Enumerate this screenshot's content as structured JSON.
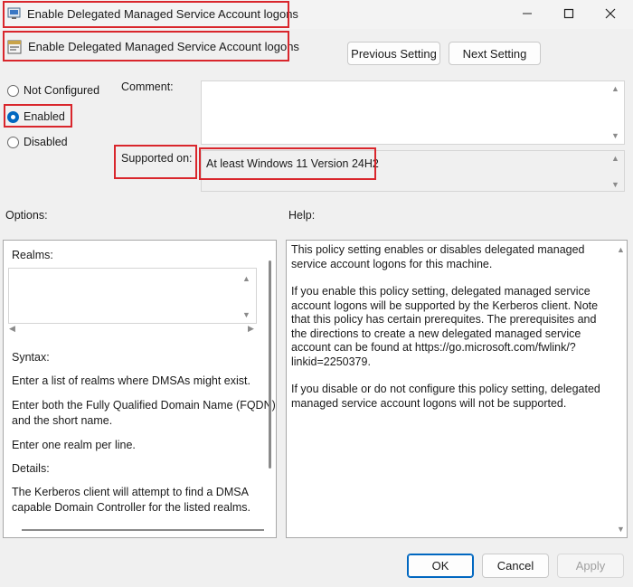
{
  "window": {
    "title": "Enable Delegated Managed Service Account logons",
    "minimize_icon": "minimize-icon",
    "maximize_icon": "maximize-icon",
    "close_icon": "close-icon"
  },
  "header": {
    "setting_name": "Enable Delegated Managed Service Account logons",
    "previous_label": "Previous Setting",
    "next_label": "Next Setting"
  },
  "state": {
    "options": [
      {
        "label": "Not Configured",
        "selected": false
      },
      {
        "label": "Enabled",
        "selected": true
      },
      {
        "label": "Disabled",
        "selected": false
      }
    ]
  },
  "comment": {
    "label": "Comment:",
    "value": ""
  },
  "supported": {
    "label": "Supported on:",
    "value": "At least Windows 11 Version 24H2"
  },
  "options_panel": {
    "heading": "Options:",
    "realms_label": "Realms:",
    "realms_value": "",
    "syntax_label": "Syntax:",
    "line1": "Enter a list of realms where DMSAs might exist.",
    "line2a": "Enter both the Fully Qualified Domain Name (FQDN)",
    "line2b": "and the short name.",
    "line3": "Enter one realm per line.",
    "details_label": "Details:",
    "line4a": "The Kerberos client will attempt to find a DMSA",
    "line4b": "capable Domain Controller for the listed realms."
  },
  "help_panel": {
    "heading": "Help:",
    "p1": "This policy setting enables or disables delegated managed service account logons for this machine.",
    "p2": "If you enable this policy setting, delegated managed service account logons will be supported by the Kerberos client. Note that this policy has certain prerequites. The prerequisites and the directions to create a new delegated managed service account can be found at https://go.microsoft.com/fwlink/?linkid=2250379.",
    "p3": "If you disable or do not configure this policy setting, delegated managed service account logons will not be supported."
  },
  "footer": {
    "ok_label": "OK",
    "cancel_label": "Cancel",
    "apply_label": "Apply"
  },
  "colors": {
    "accent": "#0067c0",
    "highlight_box": "#d9262c"
  }
}
